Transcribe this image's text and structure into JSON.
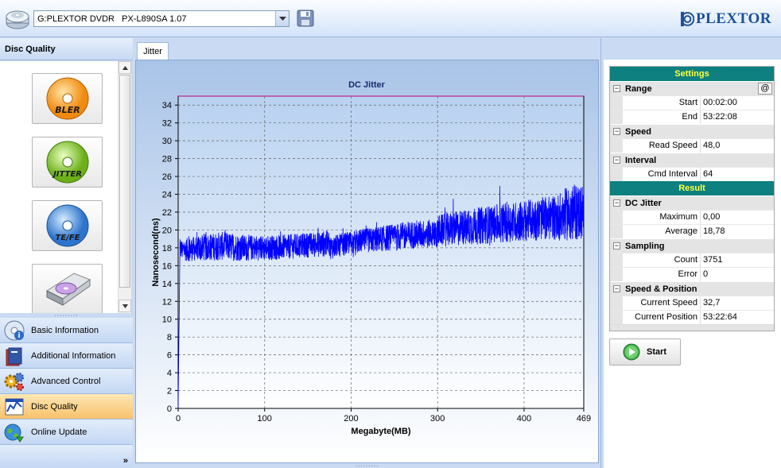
{
  "window": {
    "drive_value": "G:PLEXTOR DVDR   PX-L890SA 1.07",
    "logo_text": "PLEXTOR"
  },
  "left_panel": {
    "title": "Disc Quality",
    "tools": [
      {
        "label": "BLER",
        "color": "#f08a10"
      },
      {
        "label": "JITTER",
        "color": "#7cc02a"
      },
      {
        "label": "TE/FE",
        "color": "#3d82d8"
      },
      {
        "label": "",
        "color": "#bbbbbb"
      }
    ],
    "nav": [
      {
        "label": "Basic Information",
        "icon": "disc-info-icon",
        "active": false
      },
      {
        "label": "Additional Information",
        "icon": "book-icon",
        "active": false
      },
      {
        "label": "Advanced Control",
        "icon": "gears-icon",
        "active": false
      },
      {
        "label": "Disc Quality",
        "icon": "disc-quality-icon",
        "active": true
      },
      {
        "label": "Online Update",
        "icon": "globe-icon",
        "active": false
      }
    ],
    "more_label": "»"
  },
  "tabs": [
    {
      "label": "Jitter",
      "active": true
    }
  ],
  "chart_data": {
    "type": "line",
    "title": "DC Jitter",
    "xlabel": "Megabyte(MB)",
    "ylabel": "Nanosecond(ns)",
    "xlim": [
      0,
      469
    ],
    "ylim": [
      0,
      35
    ],
    "x_ticks": [
      0,
      100,
      200,
      300,
      400,
      469
    ],
    "y_ticks": [
      0,
      2,
      4,
      6,
      8,
      10,
      12,
      14,
      16,
      18,
      20,
      22,
      24,
      26,
      28,
      30,
      32,
      34
    ],
    "grid": true,
    "series": [
      {
        "color": "#0000ff",
        "x": [
          0,
          2,
          10,
          30,
          50,
          75,
          100,
          125,
          150,
          175,
          176,
          200,
          225,
          250,
          275,
          300,
          301,
          325,
          350,
          375,
          400,
          425,
          440,
          441,
          450,
          460,
          469
        ],
        "y": [
          0,
          17.8,
          17.8,
          18.0,
          18.2,
          18.0,
          18.0,
          18.1,
          18.3,
          18.5,
          18.0,
          18.6,
          18.9,
          19.2,
          19.5,
          19.6,
          19.9,
          20.2,
          20.5,
          20.8,
          21.0,
          21.3,
          21.5,
          21.6,
          21.8,
          22.0,
          22.0
        ],
        "spread": [
          0,
          1.2,
          1.3,
          1.5,
          1.6,
          1.5,
          1.4,
          1.4,
          1.4,
          1.5,
          1.3,
          1.3,
          1.4,
          1.5,
          1.6,
          1.6,
          1.8,
          2.0,
          2.1,
          2.2,
          2.3,
          2.4,
          2.6,
          2.8,
          3.0,
          3.2,
          3.2
        ]
      }
    ]
  },
  "settings": {
    "title": "Settings",
    "at_label": "@",
    "groups": [
      {
        "name": "Range",
        "rows": [
          {
            "k": "Start",
            "v": "00:02:00"
          },
          {
            "k": "End",
            "v": "53:22:08"
          }
        ]
      },
      {
        "name": "Speed",
        "rows": [
          {
            "k": "Read Speed",
            "v": "48,0"
          }
        ]
      },
      {
        "name": "Interval",
        "rows": [
          {
            "k": "Cmd Interval",
            "v": "64"
          }
        ]
      }
    ]
  },
  "result": {
    "title": "Result",
    "groups": [
      {
        "name": "DC Jitter",
        "rows": [
          {
            "k": "Maximum",
            "v": "0,00"
          },
          {
            "k": "Average",
            "v": "18,78"
          }
        ]
      },
      {
        "name": "Sampling",
        "rows": [
          {
            "k": "Count",
            "v": "3751"
          },
          {
            "k": "Error",
            "v": "0"
          }
        ]
      },
      {
        "name": "Speed & Position",
        "rows": [
          {
            "k": "Current Speed",
            "v": "32,7"
          },
          {
            "k": "Current Position",
            "v": "53:22:64"
          }
        ]
      }
    ]
  },
  "start_button": {
    "label": "Start"
  }
}
